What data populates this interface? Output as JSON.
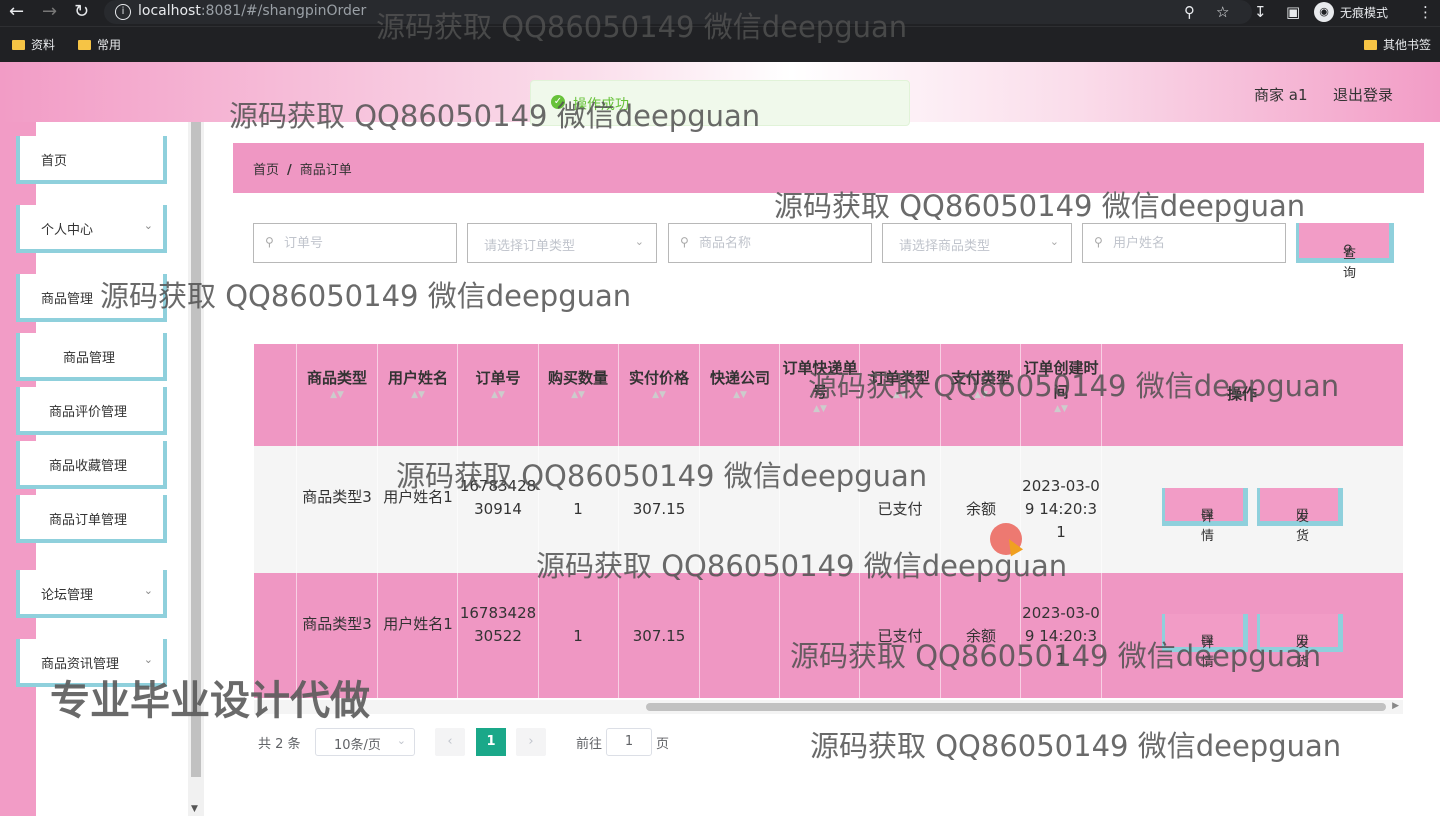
{
  "browser": {
    "url_host": "localhost",
    "url_path": ":8081/#/shangpinOrder",
    "incognito_label": "无痕模式",
    "bookmarks": [
      "资料",
      "常用"
    ],
    "other_bookmarks": "其他书签"
  },
  "header": {
    "user": "商家 a1",
    "logout": "退出登录"
  },
  "toast": {
    "text": "操作成功"
  },
  "sidebar": {
    "items": [
      {
        "label": "首页"
      },
      {
        "label": "个人中心"
      },
      {
        "label": "商品管理"
      },
      {
        "label": "商品管理"
      },
      {
        "label": "商品评价管理"
      },
      {
        "label": "商品收藏管理"
      },
      {
        "label": "商品订单管理"
      },
      {
        "label": "论坛管理"
      },
      {
        "label": "商品资讯管理"
      }
    ]
  },
  "breadcrumb": {
    "home": "首页",
    "separator": "/",
    "current": "商品订单"
  },
  "search": {
    "order_no_placeholder": "订单号",
    "order_type_placeholder": "请选择订单类型",
    "product_name_placeholder": "商品名称",
    "product_type_placeholder": "请选择商品类型",
    "user_name_placeholder": "用户姓名",
    "query_label": "查询"
  },
  "table": {
    "headers": [
      "商品类型",
      "用户姓名",
      "订单号",
      "购买数量",
      "实付价格",
      "快递公司",
      "订单快递单号",
      "订单类型",
      "支付类型",
      "订单创建时间",
      "操作"
    ],
    "rows": [
      {
        "product_type": "商品类型3",
        "user_name": "用户姓名1",
        "order_no": "1678342830914",
        "quantity": "1",
        "price": "307.15",
        "courier": "",
        "tracking_no": "",
        "order_type": "已支付",
        "pay_type": "余额",
        "created": "2023-03-09 14:20:31"
      },
      {
        "product_type": "商品类型3",
        "user_name": "用户姓名1",
        "order_no": "1678342830522",
        "quantity": "1",
        "price": "307.15",
        "courier": "",
        "tracking_no": "",
        "order_type": "已支付",
        "pay_type": "余额",
        "created": "2023-03-09 14:20:31"
      }
    ],
    "detail_label": "详情",
    "ship_label": "发货"
  },
  "pagination": {
    "total": "共 2 条",
    "page_size": "10条/页",
    "current_page": "1",
    "goto_label": "前往",
    "goto_value": "1",
    "page_suffix": "页"
  },
  "overlays": {
    "watermark": "源码获取 QQ86050149 微信deepguan",
    "promo": "专业毕业设计代做"
  },
  "colors": {
    "primary_pink": "#ef97c3",
    "accent_teal": "#8fd0dc",
    "pagination_active": "#1aa889"
  }
}
